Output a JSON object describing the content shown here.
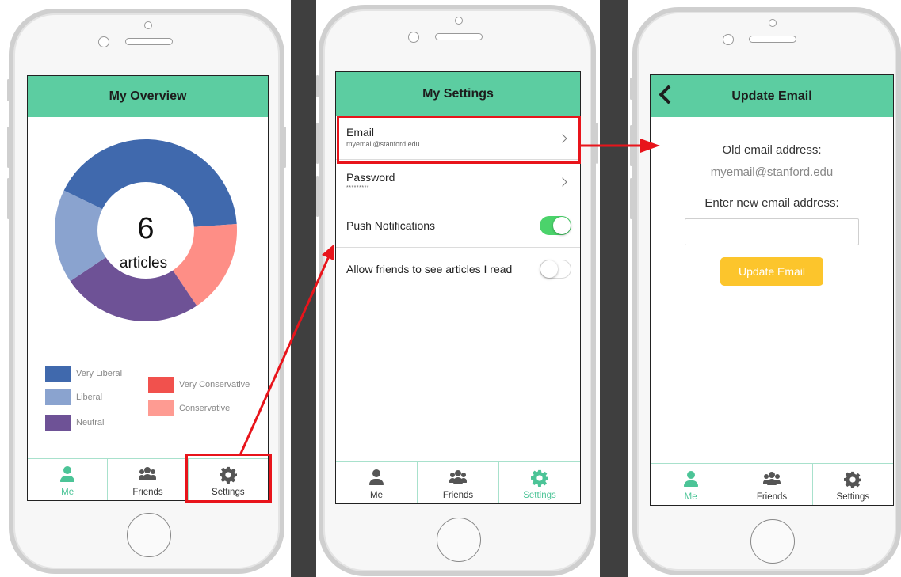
{
  "overview": {
    "title": "My Overview",
    "donut_count": "6",
    "donut_label": "articles",
    "chart_data": {
      "type": "pie",
      "slices": [
        {
          "label": "Very Liberal",
          "color": "#4069ad",
          "sweep_deg": 150
        },
        {
          "label": "Very Conservative",
          "color": "#fe8e86",
          "sweep_deg": 60
        },
        {
          "label": "Neutral",
          "color": "#6e5296",
          "sweep_deg": 90
        },
        {
          "label": "Liberal",
          "color": "#8aa3cf",
          "sweep_deg": 60
        }
      ]
    },
    "legend": [
      {
        "label": "Very Liberal",
        "color": "#4069ad"
      },
      {
        "label": "Liberal",
        "color": "#8aa3cf"
      },
      {
        "label": "Neutral",
        "color": "#6e5296"
      },
      {
        "label": "Very Conservative",
        "color": "#f1514d"
      },
      {
        "label": "Conservative",
        "color": "#fe9b92"
      }
    ]
  },
  "settings": {
    "title": "My Settings",
    "email_label": "Email",
    "email_value": "myemail@stanford.edu",
    "password_label": "Password",
    "password_value": "*********",
    "push_label": "Push Notifications",
    "push_on": true,
    "friends_label": "Allow friends to see articles I read",
    "friends_on": false
  },
  "update_email": {
    "title": "Update Email",
    "old_label": "Old email address:",
    "old_value": "myemail@stanford.edu",
    "new_label": "Enter new email address:",
    "new_value": "",
    "button_label": "Update Email"
  },
  "tabs": {
    "me": "Me",
    "friends": "Friends",
    "settings": "Settings"
  },
  "colors": {
    "header": "#5ccda1",
    "tab_active": "#4cc497",
    "highlight": "#e8141b",
    "button": "#fcc52c",
    "toggle_on": "#4bd36b"
  }
}
